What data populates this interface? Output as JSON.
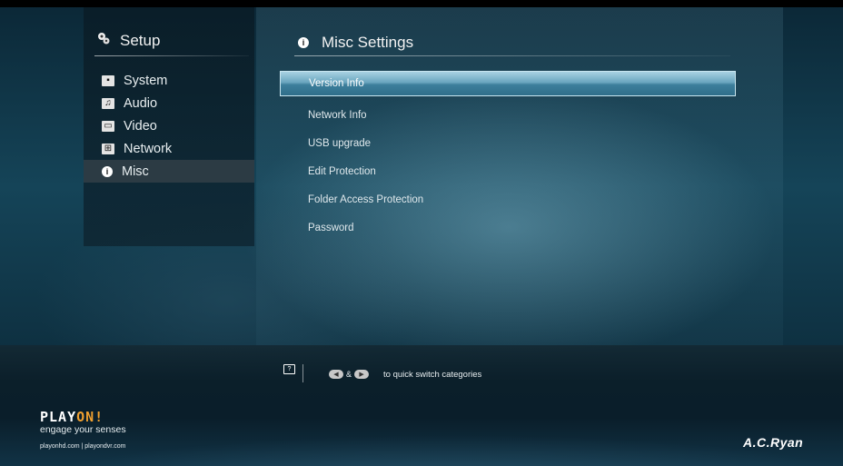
{
  "sidebar": {
    "title": "Setup",
    "items": [
      {
        "label": "System",
        "icon": "system-icon",
        "selected": false
      },
      {
        "label": "Audio",
        "icon": "audio-icon",
        "selected": false
      },
      {
        "label": "Video",
        "icon": "video-icon",
        "selected": false
      },
      {
        "label": "Network",
        "icon": "network-icon",
        "selected": false
      },
      {
        "label": "Misc",
        "icon": "misc-icon",
        "selected": true
      }
    ]
  },
  "main": {
    "title": "Misc Settings",
    "items": [
      {
        "label": "Version Info",
        "selected": true
      },
      {
        "label": "Network Info",
        "selected": false
      },
      {
        "label": "USB upgrade",
        "selected": false
      },
      {
        "label": "Edit Protection",
        "selected": false
      },
      {
        "label": "Folder Access Protection",
        "selected": false
      },
      {
        "label": "Password",
        "selected": false
      }
    ]
  },
  "hint": {
    "amp": "&",
    "text": "to quick switch categories"
  },
  "brand": {
    "logo_main": "PLAY",
    "logo_accent": "ON!",
    "tagline": "engage your senses",
    "urls": "playonhd.com | playondvr.com",
    "maker": "A.C.Ryan"
  },
  "colors": {
    "highlight": "#5a9cb8",
    "logo_accent": "#f0a030",
    "sidebar_selected": "#2c3b44"
  }
}
